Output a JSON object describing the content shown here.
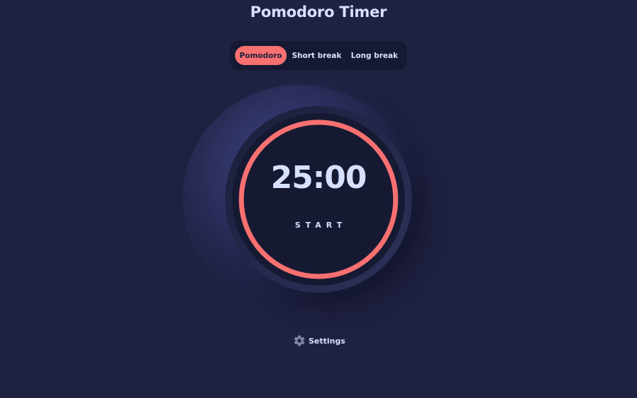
{
  "app": {
    "title": "Pomodoro Timer"
  },
  "modes": [
    {
      "label": "Pomodoro",
      "active": true
    },
    {
      "label": "Short break",
      "active": false
    },
    {
      "label": "Long break",
      "active": false
    }
  ],
  "timer": {
    "time": "25:00",
    "action_label": "START",
    "progress": 1.0
  },
  "settings": {
    "label": "Settings",
    "icon": "gear-icon"
  },
  "colors": {
    "background": "#1f2141",
    "panel": "#161933",
    "accent": "#f87070",
    "text": "#d7e0ff"
  }
}
